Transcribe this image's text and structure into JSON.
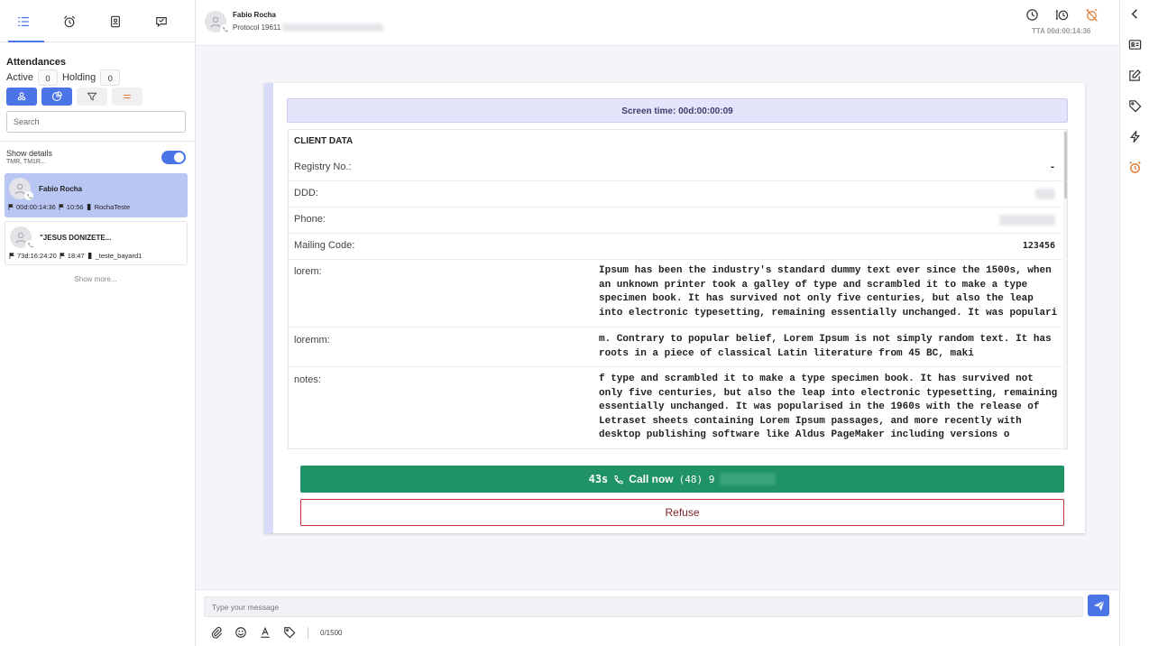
{
  "sidebar": {
    "tabs": [
      {
        "icon": "list-icon",
        "active": true
      },
      {
        "icon": "alarm-clock-icon",
        "active": false
      },
      {
        "icon": "contact-card-icon",
        "active": false
      },
      {
        "icon": "chat-bubble-icon",
        "active": false
      }
    ],
    "section_title": "Attendances",
    "active_label": "Active",
    "active_count": "0",
    "holding_label": "Holding",
    "holding_count": "0",
    "search_placeholder": "Search",
    "show_details_label": "Show details",
    "show_details_sub": "TMR, TM1R...",
    "show_details_on": true,
    "cards": [
      {
        "name": "Fabio Rocha",
        "timer": "00d:00:14:36",
        "time": "10:56",
        "queue": "RochaTeste",
        "selected": true
      },
      {
        "name": "\"JESUS DONIZETE...",
        "timer": "73d:16:24:20",
        "time": "18:47",
        "queue": "_teste_bayard1",
        "selected": false
      }
    ],
    "show_more": "Show more..."
  },
  "header": {
    "name": "Fabio Rocha",
    "protocol": "Protocol 19611",
    "tta": "TTA 00d:00:14:36"
  },
  "panel": {
    "screen_time": "Screen time: 00d:00:00:09",
    "client_data_title": "CLIENT DATA",
    "rows": {
      "registry": {
        "label": "Registry No.:",
        "value": "-"
      },
      "ddd": {
        "label": "DDD:"
      },
      "phone": {
        "label": "Phone:"
      },
      "mailing": {
        "label": "Mailing Code:",
        "value": "123456"
      },
      "lorem": {
        "label": "lorem:",
        "value": "Ipsum has been the industry's standard dummy text ever since the 1500s, when\nan unknown printer took a galley of type and scrambled it to make a type\nspecimen book. It has survived not only five centuries, but also the leap\ninto electronic typesetting, remaining essentially unchanged. It was populari"
      },
      "loremm": {
        "label": "loremm:",
        "value": "m. Contrary to popular belief, Lorem Ipsum is not simply random text. It has\nroots in a piece of classical Latin literature from 45 BC, maki"
      },
      "notes": {
        "label": "notes:",
        "value": "f type and scrambled it to make a type specimen book. It has survived not\nonly five centuries, but also the leap into electronic typesetting, remaining\nessentially unchanged. It was popularised in the 1960s with the release of\nLetraset sheets containing Lorem Ipsum passages, and more recently with\ndesktop publishing software like Aldus PageMaker including versions o"
      }
    },
    "call": {
      "seconds": "43s",
      "label": "Call now",
      "number": "(48) 9"
    },
    "refuse_label": "Refuse"
  },
  "composer": {
    "placeholder": "Type your message",
    "char_count": "0/1500"
  },
  "colors": {
    "accent": "#4b74e6",
    "call_green": "#1f9266",
    "refuse_red": "#c9323f",
    "alert_orange": "#e07a2e"
  }
}
